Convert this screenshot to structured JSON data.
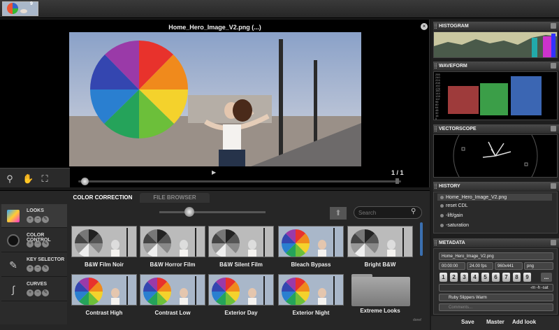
{
  "filmstrip": {
    "badge": "9"
  },
  "viewer": {
    "title": "Home_Hero_Image_V2.png (...)",
    "close_glyph": "×",
    "page_count": "1 / 1",
    "play_glyph": "▶",
    "tools": [
      {
        "name": "zoom-icon",
        "glyph": "⚲"
      },
      {
        "name": "hand-icon",
        "glyph": "✋"
      },
      {
        "name": "fullscreen-icon",
        "glyph": "⛶"
      }
    ]
  },
  "tabs": {
    "color_correction": "COLOR CORRECTION",
    "file_browser": "FILE BROWSER"
  },
  "leftnav": [
    {
      "label": "LOOKS"
    },
    {
      "label": "COLOR CONTROL"
    },
    {
      "label": "KEY SELECTOR"
    },
    {
      "label": "CURVES"
    }
  ],
  "search": {
    "placeholder": "Search"
  },
  "looks": [
    {
      "label": "B&W Film Noir",
      "tone": "bw"
    },
    {
      "label": "B&W Horror Film",
      "tone": "bw"
    },
    {
      "label": "B&W Silent Film",
      "tone": "bw"
    },
    {
      "label": "Bleach Bypass",
      "tone": "color"
    },
    {
      "label": "Bright B&W",
      "tone": "bw"
    },
    {
      "label": "Contrast High",
      "tone": "color"
    },
    {
      "label": "Contrast Low",
      "tone": "color"
    },
    {
      "label": "Exterior Day",
      "tone": "color"
    },
    {
      "label": "Exterior Night",
      "tone": "color"
    },
    {
      "label": "Extreme Looks",
      "tone": "folder"
    }
  ],
  "corner_tag": "done!",
  "right": {
    "histogram": "HISTOGRAM",
    "waveform": "WAVEFORM",
    "vectorscope": "VECTORSCOPE",
    "history": "HISTORY",
    "metadata": "METADATA",
    "history_items": [
      "Home_Hero_Image_V2.png",
      "reset CDL",
      "-lift/gain",
      "-saturation"
    ],
    "waveform_ticks": [
      "255",
      "240",
      "224",
      "208",
      "192",
      "176",
      "160",
      "144",
      "128",
      "112",
      "96",
      "80",
      "64",
      "48",
      "32",
      "16",
      "0"
    ]
  },
  "metadata": {
    "filename": "Home_Hero_Image_V2.png",
    "timecode": "00:00:00",
    "fps": "24.00 fps",
    "size": "960x441",
    "format": "png",
    "rating_numbers": [
      "1",
      "2",
      "3",
      "4",
      "5",
      "6",
      "7",
      "8",
      "9"
    ],
    "rating_more": "...",
    "flags": "-m -h -sat",
    "look_name": "Ruby Slippers Warm",
    "comments_placeholder": "Comments..."
  },
  "bottom_buttons": {
    "save": "Save",
    "master": "Master",
    "add_look": "Add look"
  }
}
